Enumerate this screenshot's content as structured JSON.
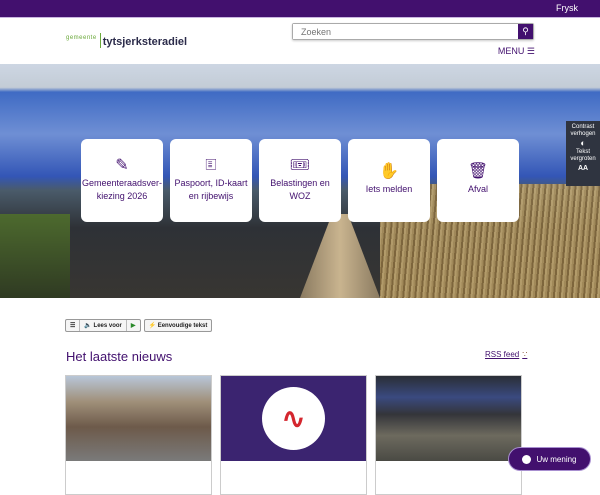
{
  "topbar": {
    "language": "Frysk"
  },
  "header": {
    "logo_prefix": "gemeente",
    "logo_name": "tytsjerksteradiel",
    "search_placeholder": "Zoeken",
    "menu_label": "MENU"
  },
  "tiles": [
    {
      "label": "Gemeenteraadsver-kiezing 2026",
      "icon": "pencil-icon"
    },
    {
      "label": "Paspoort, ID-kaart en rijbewijs",
      "icon": "id-card-icon"
    },
    {
      "label": "Belastingen en WOZ",
      "icon": "tax-ticket-icon"
    },
    {
      "label": "Iets melden",
      "icon": "person-raising-hand-icon"
    },
    {
      "label": "Afval",
      "icon": "waste-bin-icon"
    }
  ],
  "accessibility": {
    "contrast": "Contrast verhogen",
    "text_size": "Tekst vergroten",
    "text_size_glyph": "AA"
  },
  "readspeaker": {
    "read_aloud": "Lees voor",
    "simple_text": "Eenvoudige tekst"
  },
  "news": {
    "title": "Het laatste nieuws",
    "rss": "RSS feed"
  },
  "feedback": {
    "label": "Uw mening"
  }
}
